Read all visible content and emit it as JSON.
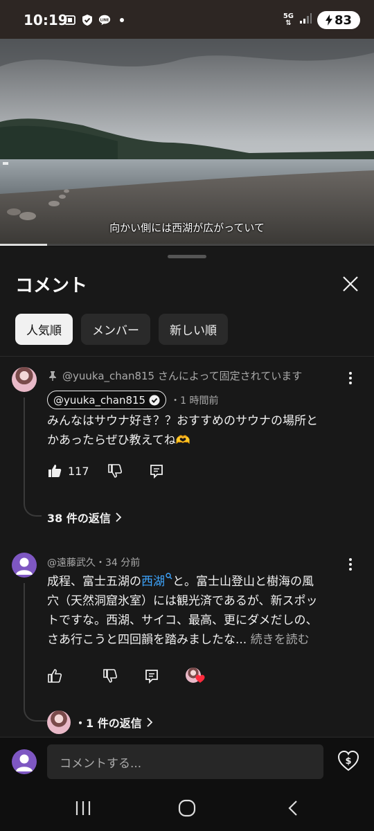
{
  "status_bar": {
    "time": "10:19",
    "network": "5G",
    "battery": "83"
  },
  "video": {
    "subtitle": "向かい側には西湖が広がっていて",
    "progress_fraction": 0.125
  },
  "panel": {
    "title": "コメント",
    "filters": [
      "人気順",
      "メンバー",
      "新しい順"
    ],
    "active_filter": "人気順"
  },
  "comments": [
    {
      "pinned_text": "@yuuka_chan815 さんによって固定されています",
      "author": "@yuuka_chan815",
      "verified": true,
      "time": "・1 時間前",
      "text_line1": "みんなはサウナ好き？？おすすめのサウナの場所と",
      "text_line2": "かあったらぜひ教えてね🫶",
      "likes": "117",
      "replies": "38 件の返信"
    },
    {
      "author_meta": "@遠藤武久・34 分前",
      "text_line1_pre": "成程、富士五湖の",
      "link": "西湖",
      "text_line1_post": "と。富士山登山と樹海の風",
      "text_line2": "穴（天然洞窟氷室）には観光済であるが、新スポッ",
      "text_line3": "トですな。西湖、サイコ、最高、更にダメだしの、",
      "text_line4": "さあ行こうと四回韻を踏みましたな...",
      "read_more": "続きを読む",
      "replies": "・1 件の返信"
    }
  ],
  "input": {
    "placeholder": "コメントする..."
  },
  "colors": {
    "background": "#0f0f0f",
    "panel": "#181818",
    "link": "#3ea6ff",
    "status_bar": "#2d2623"
  }
}
